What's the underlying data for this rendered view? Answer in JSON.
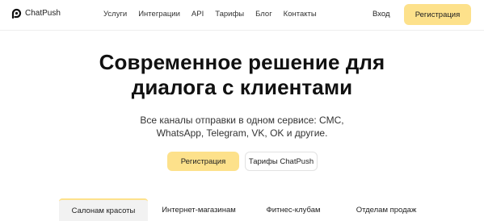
{
  "header": {
    "logo_text": "ChatPush",
    "nav": [
      "Услуги",
      "Интеграции",
      "API",
      "Тарифы",
      "Блог",
      "Контакты"
    ],
    "login_label": "Вход",
    "register_label": "Регистрация"
  },
  "hero": {
    "title_line1": "Современное решение для",
    "title_line2": "диалога с клиентами",
    "subtitle_line1": "Все каналы отправки в одном сервисе: СМС,",
    "subtitle_line2": "WhatsApp, Telegram, VK, OK и другие.",
    "register_label": "Регистрация",
    "tariffs_label": "Тарифы ChatPush"
  },
  "tabs": [
    "Салонам красоты",
    "Интернет-магазинам",
    "Фитнес-клубам",
    "Отделам продаж"
  ],
  "active_tab": "Салонам красоты",
  "colors": {
    "accent": "#fde18b",
    "text": "#222222",
    "tab_bg": "#f2f2f2"
  },
  "icons": {
    "logo": "chatpush-logo-icon"
  }
}
